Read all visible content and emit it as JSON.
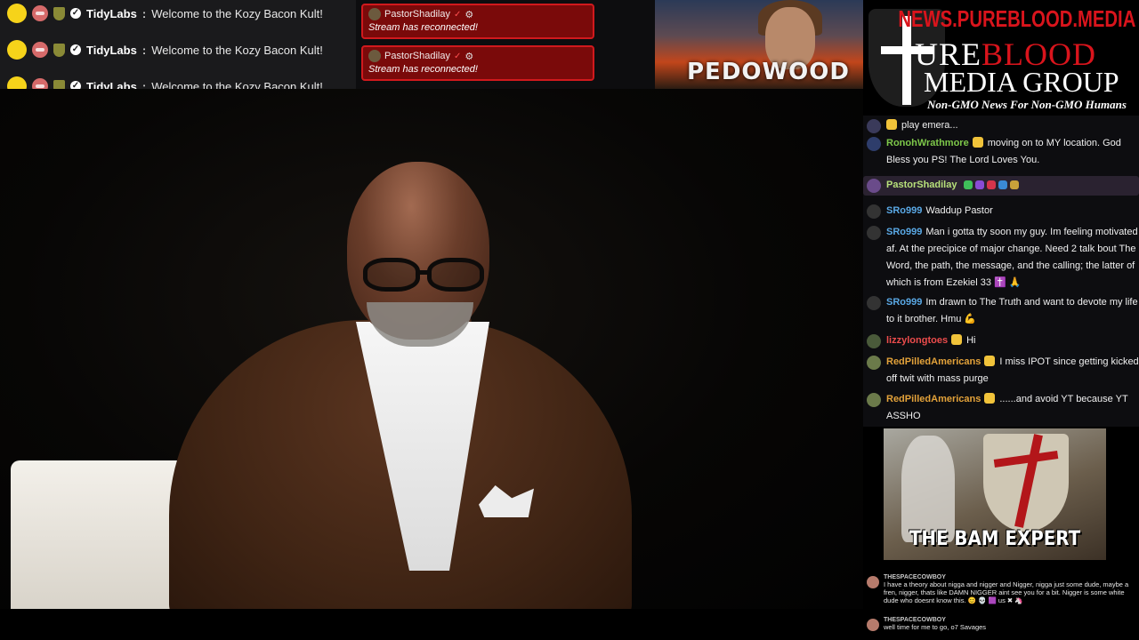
{
  "ticker": {
    "rows": [
      {
        "user": "TidyLabs",
        "sep": ":",
        "message": "Welcome to the Kozy Bacon Kult!"
      },
      {
        "user": "TidyLabs",
        "sep": ":",
        "message": "Welcome to the Kozy Bacon Kult!"
      },
      {
        "user": "TidyLabs",
        "sep": ":",
        "message": "Welcome to the Kozy Bacon Kult!"
      }
    ]
  },
  "notices": [
    {
      "user": "PastorShadilay",
      "badge": "✓",
      "message": "Stream has reconnected!"
    },
    {
      "user": "PastorShadilay",
      "badge": "✓",
      "message": "Stream has reconnected!"
    }
  ],
  "thumbnail": {
    "text": "PEDOWOOD"
  },
  "logo": {
    "url": "NEWS.PUREBLOOD.MEDIA",
    "line1_a": "URE",
    "line1_b": "BLOOD",
    "line2": "MEDIA GROUP",
    "tagline": "Non-GMO News For Non-GMO Humans"
  },
  "chat": {
    "rows": [
      {
        "user": "",
        "message": "play emera..."
      },
      {
        "user": "RonohWrathmore",
        "message": "moving on to MY location. God Bless you PS! The Lord Loves You."
      },
      {
        "user": "PastorShadilay",
        "message": ""
      },
      {
        "user": "SRo999",
        "message": "Waddup Pastor"
      },
      {
        "user": "SRo999",
        "message": "Man i gotta tty soon my guy. Im feeling motivated af. At the precipice of major change. Need 2 talk bout The Word, the path, the message, and the calling; the latter of which is from Ezekiel 33 ✝️ 🙏"
      },
      {
        "user": "SRo999",
        "message": "Im drawn to The Truth and want to devote my life to it brother. Hmu 💪"
      },
      {
        "user": "lizzylongtoes",
        "message": "Hi"
      },
      {
        "user": "RedPilledAmericans",
        "message": "I miss IPOT since getting kicked off twit with mass purge"
      },
      {
        "user": "RedPilledAmericans",
        "message": "......and avoid YT because YT ASSHO"
      }
    ]
  },
  "meme": {
    "caption": "THE BAM EXPERT"
  },
  "mini_chat": {
    "rows": [
      {
        "user": "THESPACECOWBOY",
        "message": "I have a theory about nigga and nigger and Nigger, nigga just some dude, maybe a fren, nigger, thats like DAMN NIGGER aint see you for a bit. Nigger is some white dude who doesnt know this. 😊 💀 🟪 us ✖ 🦄"
      },
      {
        "user": "THESPACECOWBOY",
        "message": "well time for me to go, o7 Savages"
      }
    ]
  }
}
